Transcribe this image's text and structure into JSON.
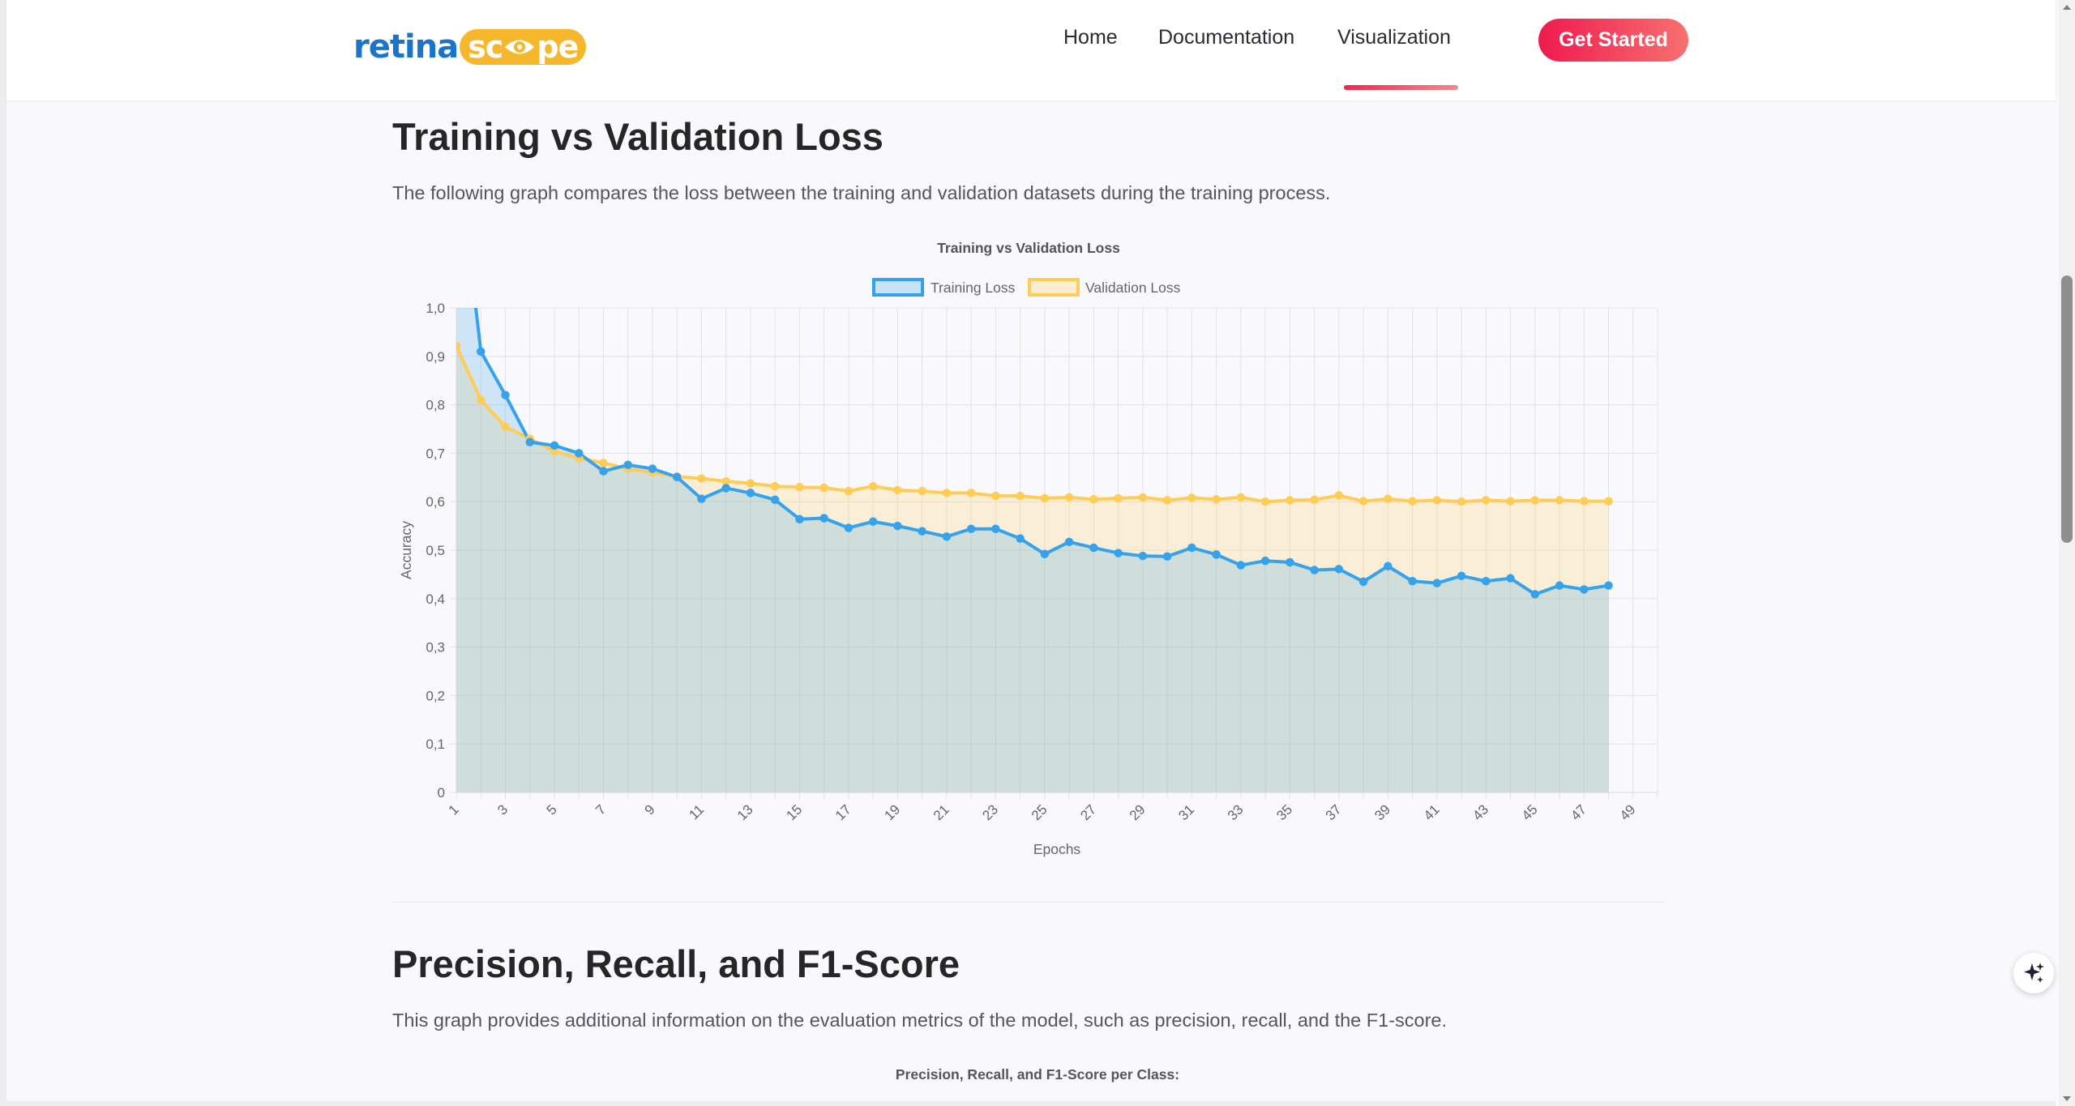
{
  "header": {
    "logo": {
      "part1": "retina",
      "part2a": "sc",
      "part2b": "pe"
    },
    "nav": [
      {
        "label": "Home"
      },
      {
        "label": "Documentation"
      },
      {
        "label": "Visualization",
        "active": true
      }
    ],
    "cta_label": "Get Started"
  },
  "section_loss": {
    "heading": "Training vs Validation Loss",
    "description": "The following graph compares the loss between the training and validation datasets during the training process."
  },
  "section_prf": {
    "heading": "Precision, Recall, and F1-Score",
    "description": "This graph provides additional information on the evaluation metrics of the model, such as precision, recall, and the F1-score.",
    "chart_title": "Precision, Recall, and F1-Score per Class:"
  },
  "icons": {
    "fab": "sparkle-icon"
  },
  "colors": {
    "training": "#36a2eb",
    "validation": "#ffcd56",
    "accent_start": "#f01a4f",
    "accent_end": "#f7706f",
    "logo_blue": "#1a74c9",
    "logo_yellow": "#f5b72c"
  },
  "chart_data": {
    "type": "line",
    "title": "Training vs Validation Loss",
    "xlabel": "Epochs",
    "ylabel": "Accuracy",
    "ylim": [
      0,
      1.0
    ],
    "yticks": [
      "0",
      "0,1",
      "0,2",
      "0,3",
      "0,4",
      "0,5",
      "0,6",
      "0,7",
      "0,8",
      "0,9",
      "1,0"
    ],
    "xticks": [
      1,
      3,
      5,
      7,
      9,
      11,
      13,
      15,
      17,
      19,
      21,
      23,
      25,
      27,
      29,
      31,
      33,
      35,
      37,
      39,
      41,
      43,
      45,
      47,
      49
    ],
    "x_range": [
      1,
      50
    ],
    "grid": true,
    "legend_position": "top",
    "filled": true,
    "series": [
      {
        "name": "Training Loss",
        "x": [
          1,
          2,
          3,
          4,
          5,
          6,
          7,
          8,
          9,
          10,
          11,
          12,
          13,
          14,
          15,
          16,
          17,
          18,
          19,
          20,
          21,
          22,
          23,
          24,
          25,
          26,
          27,
          28,
          29,
          30,
          31,
          32,
          33,
          34,
          35,
          36,
          37,
          38,
          39,
          40,
          41,
          42,
          43,
          44,
          45,
          46,
          47,
          48
        ],
        "values": [
          1.35,
          0.91,
          0.82,
          0.723,
          0.716,
          0.7,
          0.663,
          0.676,
          0.668,
          0.651,
          0.606,
          0.628,
          0.618,
          0.604,
          0.564,
          0.566,
          0.546,
          0.559,
          0.55,
          0.539,
          0.528,
          0.544,
          0.544,
          0.524,
          0.492,
          0.517,
          0.505,
          0.494,
          0.488,
          0.487,
          0.505,
          0.491,
          0.469,
          0.478,
          0.475,
          0.459,
          0.461,
          0.435,
          0.467,
          0.436,
          0.432,
          0.447,
          0.436,
          0.442,
          0.409,
          0.427,
          0.419,
          0.427
        ]
      },
      {
        "name": "Validation Loss",
        "x": [
          1,
          2,
          3,
          4,
          5,
          6,
          7,
          8,
          9,
          10,
          11,
          12,
          13,
          14,
          15,
          16,
          17,
          18,
          19,
          20,
          21,
          22,
          23,
          24,
          25,
          26,
          27,
          28,
          29,
          30,
          31,
          32,
          33,
          34,
          35,
          36,
          37,
          38,
          39,
          40,
          41,
          42,
          43,
          44,
          45,
          46,
          47,
          48
        ],
        "values": [
          0.922,
          0.81,
          0.755,
          0.73,
          0.704,
          0.69,
          0.68,
          0.668,
          0.66,
          0.652,
          0.648,
          0.642,
          0.638,
          0.632,
          0.63,
          0.629,
          0.622,
          0.632,
          0.624,
          0.622,
          0.618,
          0.618,
          0.612,
          0.612,
          0.607,
          0.609,
          0.605,
          0.607,
          0.609,
          0.603,
          0.608,
          0.605,
          0.609,
          0.6,
          0.603,
          0.604,
          0.613,
          0.601,
          0.606,
          0.601,
          0.603,
          0.6,
          0.603,
          0.601,
          0.603,
          0.603,
          0.601,
          0.601
        ]
      }
    ]
  }
}
